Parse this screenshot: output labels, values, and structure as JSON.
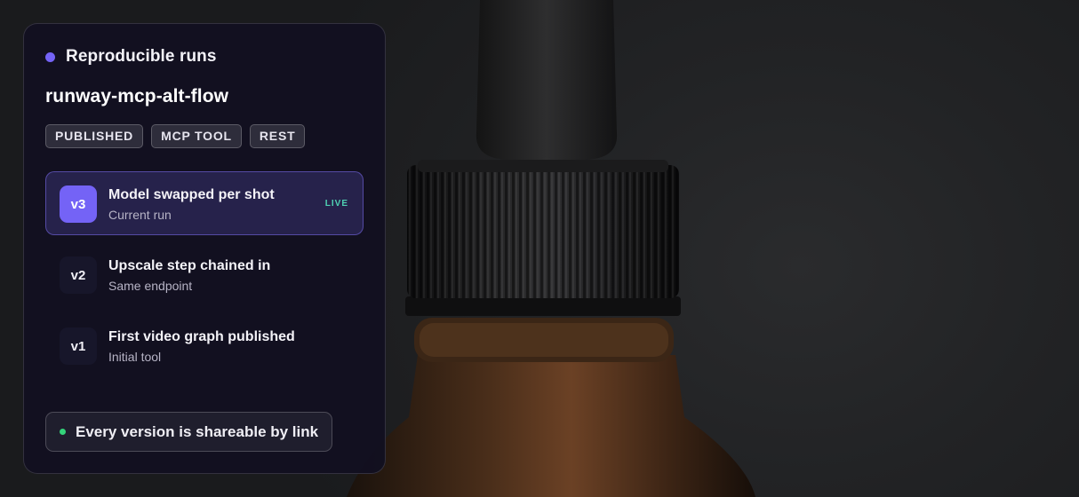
{
  "card": {
    "title": "Reproducible runs",
    "flow_name": "runway-mcp-alt-flow",
    "tags": [
      "PUBLISHED",
      "MCP TOOL",
      "REST"
    ],
    "versions": [
      {
        "badge": "v3",
        "title": "Model swapped per shot",
        "subtitle": "Current run",
        "status": "LIVE",
        "active": true
      },
      {
        "badge": "v2",
        "title": "Upscale step chained in",
        "subtitle": "Same endpoint",
        "status": "",
        "active": false
      },
      {
        "badge": "v1",
        "title": "First video graph published",
        "subtitle": "Initial tool",
        "status": "",
        "active": false
      }
    ],
    "footer": "Every version is shareable by link"
  },
  "colors": {
    "accent": "#7463f6",
    "live": "#4fd1b2",
    "success_dot": "#34d37a"
  },
  "background": {
    "subject": "amber-glass-dropper-bottle-photo"
  }
}
